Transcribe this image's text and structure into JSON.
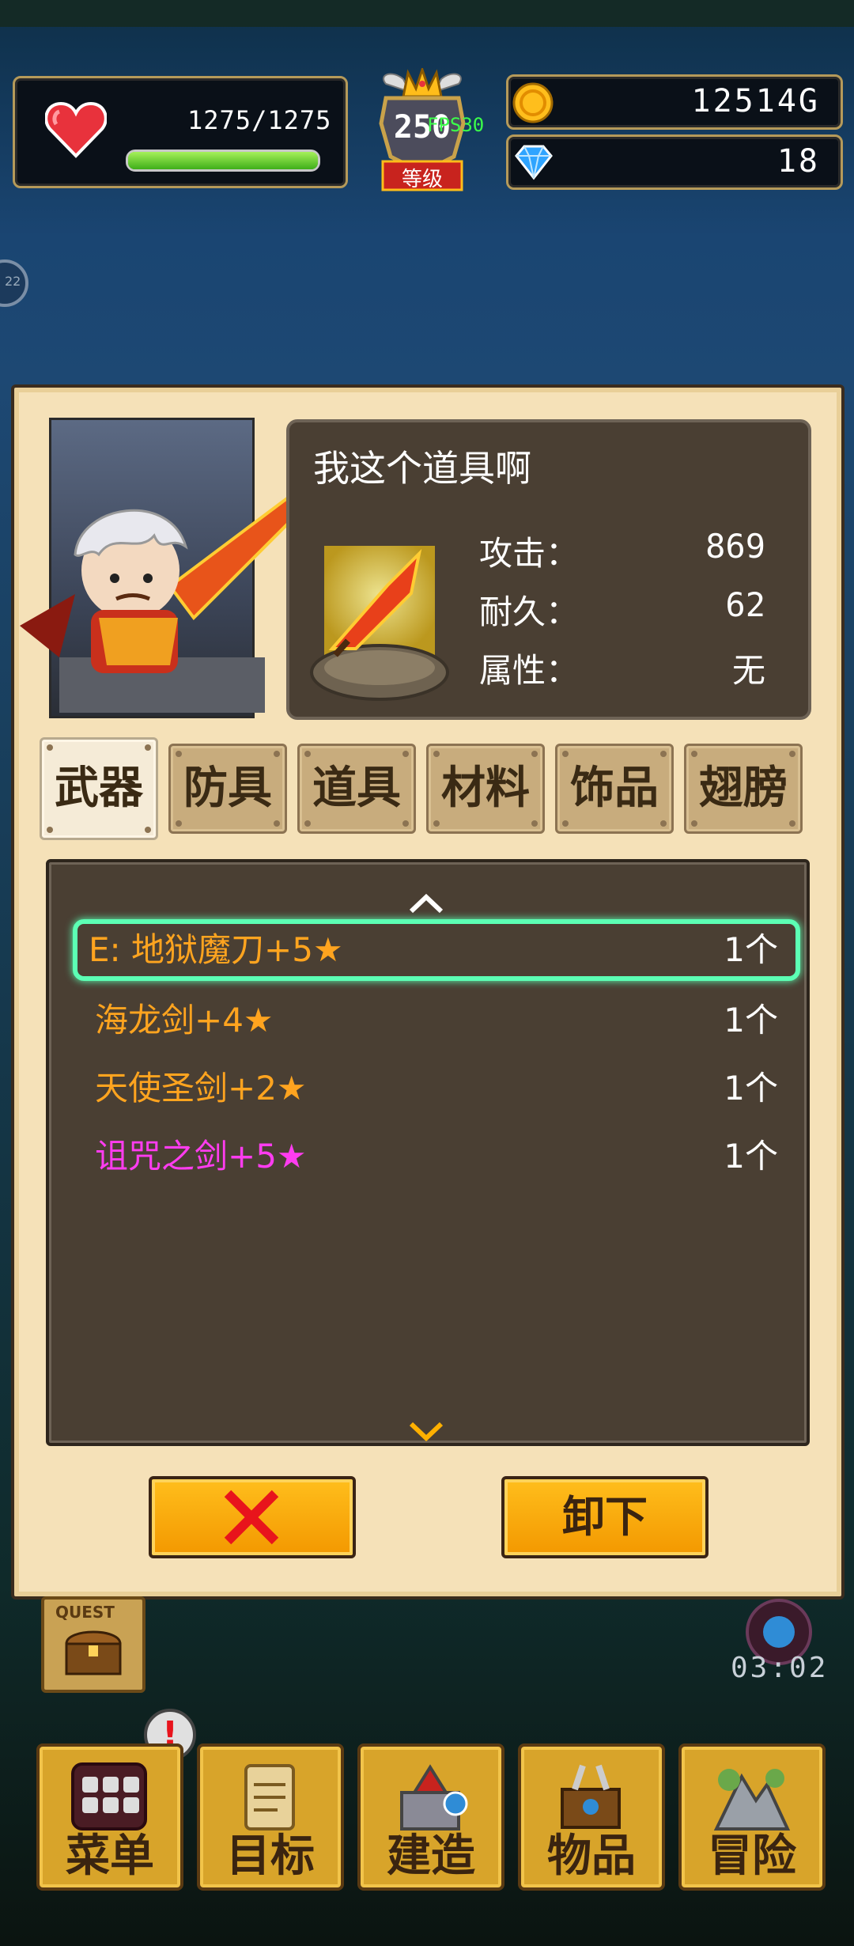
{
  "hud": {
    "hp_text": "1275/1275",
    "hp_fraction": 1.0,
    "level": "250",
    "fps": "FPS30",
    "level_label": "等级",
    "gold": "12514G",
    "gems": "18",
    "left_badge": "22"
  },
  "item": {
    "name": "我这个道具啊",
    "stats": [
      {
        "label": "攻击：",
        "value": "869"
      },
      {
        "label": "耐久：",
        "value": "62"
      },
      {
        "label": "属性：",
        "value": "无"
      }
    ]
  },
  "tabs": [
    "武器",
    "防具",
    "道具",
    "材料",
    "饰品",
    "翅膀"
  ],
  "list": [
    {
      "name": "E: 地狱魔刀+5★",
      "count": "1个",
      "color": "#ffa41f",
      "selected": true
    },
    {
      "name": "海龙剑+4★",
      "count": "1个",
      "color": "#ffa41f",
      "selected": false
    },
    {
      "name": "天使圣剑+2★",
      "count": "1个",
      "color": "#ffa41f",
      "selected": false
    },
    {
      "name": "诅咒之剑+5★",
      "count": "1个",
      "color": "#ff3cf0",
      "selected": false
    }
  ],
  "buttons": {
    "unequip": "卸下"
  },
  "timer": "03:02",
  "quest_label": "QUEST",
  "bottom_nav": [
    "菜单",
    "目标",
    "建造",
    "物品",
    "冒险"
  ],
  "colors": {
    "orange_item": "#ffa41f",
    "purple_item": "#ff3cf0",
    "selection_glow": "#5cffb4"
  }
}
